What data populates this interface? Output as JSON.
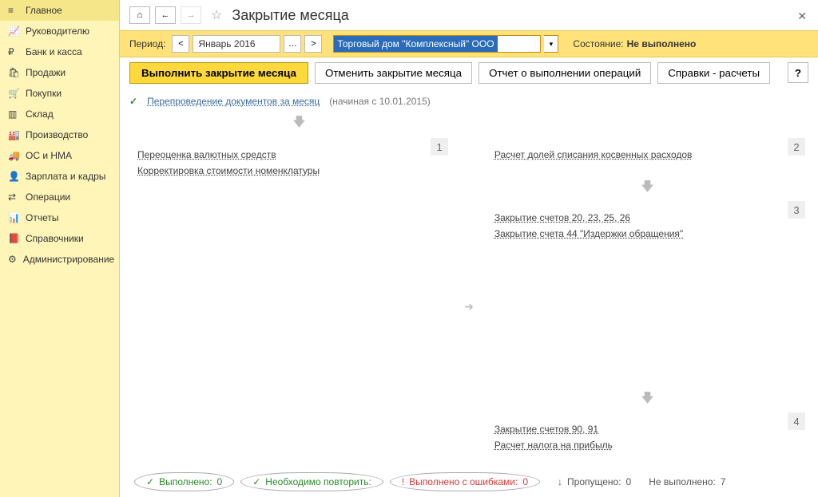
{
  "sidebar": {
    "items": [
      {
        "label": "Главное"
      },
      {
        "label": "Руководителю"
      },
      {
        "label": "Банк и касса"
      },
      {
        "label": "Продажи"
      },
      {
        "label": "Покупки"
      },
      {
        "label": "Склад"
      },
      {
        "label": "Производство"
      },
      {
        "label": "ОС и НМА"
      },
      {
        "label": "Зарплата и кадры"
      },
      {
        "label": "Операции"
      },
      {
        "label": "Отчеты"
      },
      {
        "label": "Справочники"
      },
      {
        "label": "Администрирование"
      }
    ]
  },
  "header": {
    "title": "Закрытие месяца"
  },
  "period": {
    "label": "Период:",
    "value": "Январь 2016",
    "organization": "Торговый дом \"Комплексный\" ООО",
    "status_label": "Состояние:",
    "status_value": "Не выполнено"
  },
  "toolbar": {
    "execute": "Выполнить закрытие месяца",
    "cancel": "Отменить закрытие месяца",
    "report": "Отчет о выполнении операций",
    "reference": "Справки - расчеты",
    "help": "?"
  },
  "repost": {
    "link": "Перепроведение документов за месяц",
    "hint": "(начиная с 10.01.2015)"
  },
  "stages": {
    "s1": {
      "num": "1",
      "op1": "Переоценка валютных средств",
      "op2": "Корректировка стоимости номенклатуры"
    },
    "s2": {
      "num": "2",
      "op1": "Расчет долей списания косвенных расходов"
    },
    "s3": {
      "num": "3",
      "op1": "Закрытие счетов 20, 23, 25, 26",
      "op2": "Закрытие счета 44 \"Издержки обращения\""
    },
    "s4": {
      "num": "4",
      "op1": "Закрытие счетов 90, 91",
      "op2": "Расчет налога на прибыль"
    }
  },
  "statusbar": {
    "done_label": "Выполнено:",
    "done_count": "0",
    "repeat_label": "Необходимо повторить:",
    "errors_label": "Выполнено с ошибками:",
    "errors_count": "0",
    "skipped_label": "Пропущено:",
    "skipped_count": "0",
    "notdone_label": "Не выполнено:",
    "notdone_count": "7"
  }
}
